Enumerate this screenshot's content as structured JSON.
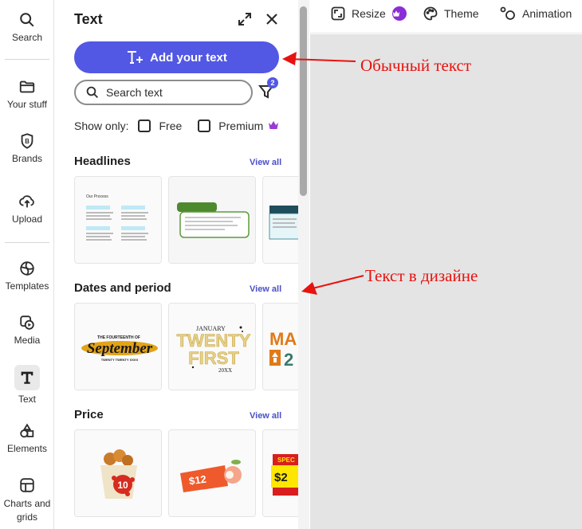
{
  "rail": {
    "items": [
      {
        "label": "Search",
        "icon": "search-icon"
      },
      {
        "label": "Your stuff",
        "icon": "folder-icon"
      },
      {
        "label": "Brands",
        "icon": "brand-icon"
      },
      {
        "label": "Upload",
        "icon": "upload-icon"
      },
      {
        "label": "Templates",
        "icon": "templates-icon"
      },
      {
        "label": "Media",
        "icon": "media-icon"
      },
      {
        "label": "Text",
        "icon": "text-icon"
      },
      {
        "label": "Elements",
        "icon": "elements-icon"
      },
      {
        "label": "Charts and grids",
        "icon": "charts-icon"
      }
    ],
    "active": "Text"
  },
  "panel": {
    "title": "Text",
    "add_button": "Add your text",
    "search_placeholder": "Search text",
    "filter_count": "2",
    "show_only": "Show only:",
    "filter_free": "Free",
    "filter_premium": "Premium",
    "sections": [
      {
        "title": "Headlines",
        "view_all": "View all"
      },
      {
        "title": "Dates and period",
        "view_all": "View all"
      },
      {
        "title": "Price",
        "view_all": "View all"
      }
    ],
    "thumb_text": {
      "our_process": "Our Process",
      "september_top": "THE FOURTEENTH OF",
      "september": "September",
      "september_bottom": "TWENTY TWENTY XXXX",
      "january": "JANUARY",
      "twenty": "TWENTY",
      "first": "FIRST",
      "year": "20XX",
      "ma": "MA",
      "price_10": "10",
      "price_12": "$12",
      "price_2": "$2",
      "spec": "SPEC"
    }
  },
  "topbar": {
    "resize": "Resize",
    "theme": "Theme",
    "animation": "Animation"
  },
  "annotations": {
    "regular_text": "Обычный текст",
    "design_text": "Текст в дизайне"
  },
  "colors": {
    "accent": "#5258e4",
    "link": "#4b50c8",
    "premium": "#9b3bd6",
    "annotation": "#e8120f"
  }
}
